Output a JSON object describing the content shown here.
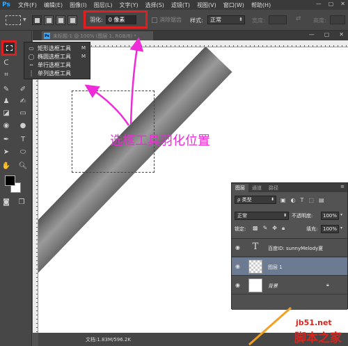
{
  "app": {
    "logo": "Ps"
  },
  "menubar": {
    "items": [
      "文件(F)",
      "编辑(E)",
      "图像(I)",
      "图层(L)",
      "文字(Y)",
      "选择(S)",
      "滤镜(T)",
      "视图(V)",
      "窗口(W)",
      "帮助(H)"
    ],
    "window_controls": [
      "—",
      "▢",
      "✕"
    ]
  },
  "options": {
    "feather_label": "羽化:",
    "feather_value": "0 像素",
    "antialias_label": "消除锯齿",
    "style_label": "样式:",
    "style_value": "正常",
    "width_label": "宽度:",
    "height_label": "高度:"
  },
  "flyout": {
    "items": [
      {
        "icon": "▭",
        "name": "矩形选框工具",
        "key": "M"
      },
      {
        "icon": "◯",
        "name": "椭圆选框工具",
        "key": "M"
      },
      {
        "icon": "┅",
        "name": "单行选框工具",
        "key": ""
      },
      {
        "icon": "┊",
        "name": "单列选框工具",
        "key": ""
      }
    ]
  },
  "document": {
    "tab_title": "未标题-1 @ 100% (图层 1, RGB/8) *",
    "tab_close": "×",
    "window_controls": [
      "—",
      "▢",
      "✕"
    ],
    "status": "文档:1.83M/596.2K",
    "annotation": "选框工具羽化位置"
  },
  "layers_panel": {
    "tabs": [
      "图层",
      "通道",
      "路径"
    ],
    "kind_value": "ρ 类型",
    "blend_value": "正常",
    "opacity_label": "不透明度:",
    "opacity_value": "100%",
    "lock_label": "锁定:",
    "fill_label": "填充:",
    "fill_value": "100%",
    "layers": [
      {
        "name": "百度ID: sunnyMelody夏",
        "type": "text"
      },
      {
        "name": "图层 1",
        "type": "pixel",
        "selected": true
      },
      {
        "name": "背景",
        "type": "background"
      }
    ]
  },
  "watermark": {
    "url": "jb51.net",
    "text": "脚本之家"
  },
  "colors": {
    "highlight": "#e02020",
    "annotation": "#ef2ad8",
    "selected_layer": "#6c7a92",
    "watermark": "#d7261d"
  }
}
